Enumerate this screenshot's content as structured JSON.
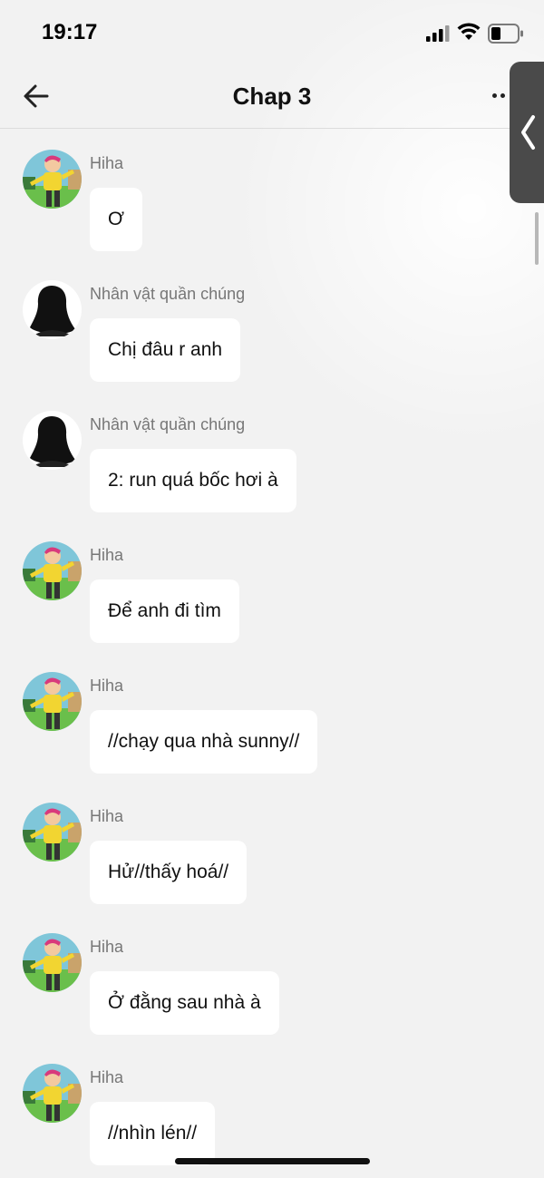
{
  "status": {
    "time": "19:17"
  },
  "header": {
    "title": "Chap 3"
  },
  "messages": [
    {
      "sender": "Hiha",
      "avatar": "cartoon-character-avatar",
      "text": "Ơ"
    },
    {
      "sender": "Nhân vật quần chúng",
      "avatar": "silhouette-avatar",
      "text": "Chị đâu r anh"
    },
    {
      "sender": "Nhân vật quần chúng",
      "avatar": "silhouette-avatar",
      "text": "2: run quá bốc hơi à"
    },
    {
      "sender": "Hiha",
      "avatar": "cartoon-character-avatar",
      "text": "Để anh đi tìm"
    },
    {
      "sender": "Hiha",
      "avatar": "cartoon-character-avatar",
      "text": "//chạy qua nhà sunny//"
    },
    {
      "sender": "Hiha",
      "avatar": "cartoon-character-avatar",
      "text": "Hử//thấy hoá//"
    },
    {
      "sender": "Hiha",
      "avatar": "cartoon-character-avatar",
      "text": "Ở đằng sau nhà à"
    },
    {
      "sender": "Hiha",
      "avatar": "cartoon-character-avatar",
      "text": "//nhìn lén//"
    }
  ],
  "colors": {
    "background": "#f2f2f2",
    "bubble": "#ffffff",
    "sender": "#777777",
    "side_tab": "#4a4a4a"
  }
}
